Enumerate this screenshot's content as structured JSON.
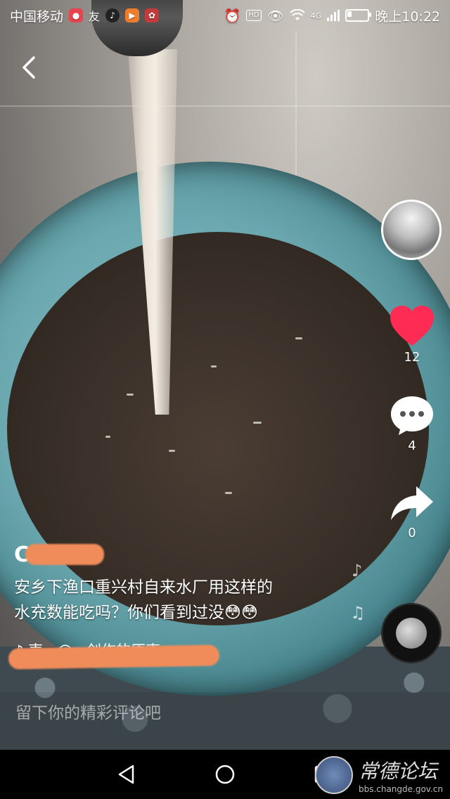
{
  "status_bar": {
    "carrier": "中国移动",
    "network": "4G",
    "time": "晚上10:22",
    "hd": "HD"
  },
  "video": {
    "author": "C",
    "caption_line1": "安乡下渔口重兴村自来水厂用这样的",
    "caption_line2": "水充数能吃吗？你们看到过没😳😳",
    "sound_text": "♪ 声  -  @...创作的原声 -"
  },
  "actions": {
    "likes": "12",
    "comments": "4",
    "shares": "0"
  },
  "comment_input": {
    "placeholder": "留下你的精彩评论吧"
  },
  "watermark": {
    "title": "常德论坛",
    "url": "bbs.changde.gov.cn"
  },
  "colors": {
    "like": "#fe2c55",
    "redaction": "#f08c5a"
  }
}
